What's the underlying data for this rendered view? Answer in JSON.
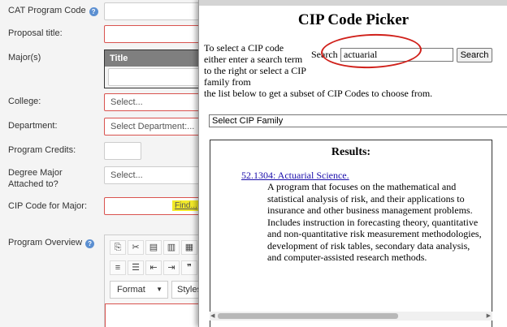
{
  "form": {
    "labels": {
      "cat_program_code": "CAT Program Code",
      "proposal_title": "Proposal title:",
      "majors": "Major(s)",
      "college": "College:",
      "department": "Department:",
      "program_credits": "Program Credits:",
      "degree_major_1": "Degree Major",
      "degree_major_2": "Attached to?",
      "cip_code": "CIP Code for Major:",
      "program_overview": "Program Overview"
    },
    "help_glyph": "?",
    "majors_table_header": "Title",
    "college_placeholder": "Select...",
    "department_placeholder": "Select Department:...",
    "degree_placeholder": "Select...",
    "find_link": "Find...",
    "editor": {
      "format_label": "Format",
      "styles_label": "Styles"
    }
  },
  "popup": {
    "title": "CIP Code Picker",
    "instructions": "To select a CIP code either enter a search term to the right or select a CIP family from",
    "instructions_cont": "the list below to get a subset of CIP Codes to choose from.",
    "search_label": "Search",
    "search_value": "actuarial",
    "search_button": "Search",
    "family_select": "Select CIP Family",
    "results_heading": "Results:",
    "result_link": "52.1304: Actuarial Science.",
    "result_description": "A program that focuses on the mathematical and statistical analysis of risk, and their applications to insurance and other business management problems. Includes instruction in forecasting theory, quantitative and non-quantitative risk measurement methodologies, development of risk tables, secondary data analysis, and computer-assisted research methods."
  },
  "colors": {
    "error_border": "#d9534f",
    "highlight": "#f3ea29",
    "annotation_circle": "#d0201a",
    "link": "#1a0dab"
  }
}
